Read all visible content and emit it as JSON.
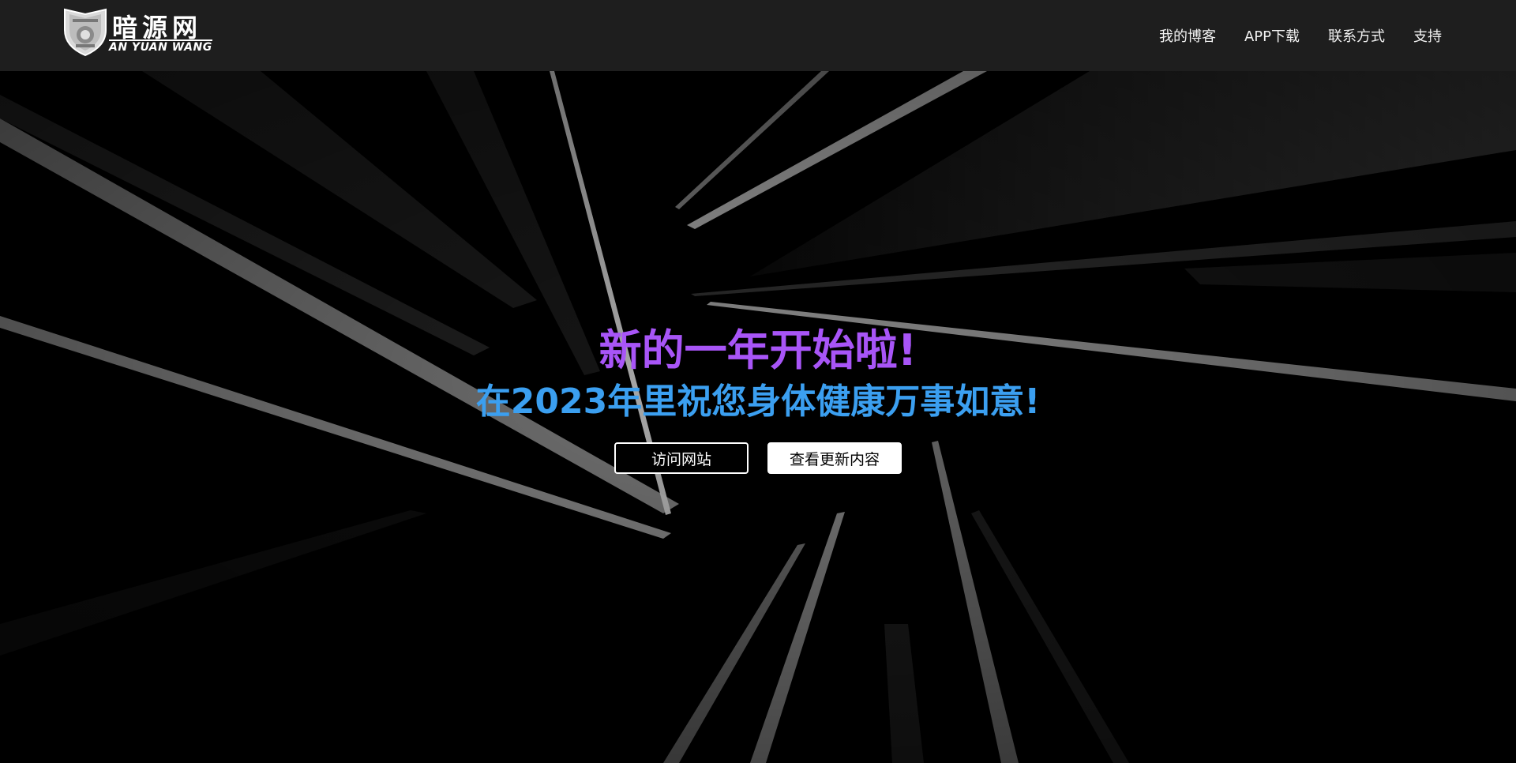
{
  "brand": {
    "name": "暗源网",
    "subtitle": "AN YUAN WANG",
    "icon": "shield-crest-logo"
  },
  "nav": {
    "items": [
      {
        "label": "我的博客"
      },
      {
        "label": "APP下载"
      },
      {
        "label": "联系方式"
      },
      {
        "label": "支持"
      }
    ]
  },
  "hero": {
    "headline": "新的一年开始啦!",
    "subheadline": "在2023年里祝您身体健康万事如意!",
    "primary_button": "访问网站",
    "secondary_button": "查看更新内容"
  },
  "colors": {
    "navbar_bg": "#1e1e1e",
    "headline": "#a855f7",
    "subheadline": "#3b9ff0",
    "hero_bg": "#000000"
  }
}
